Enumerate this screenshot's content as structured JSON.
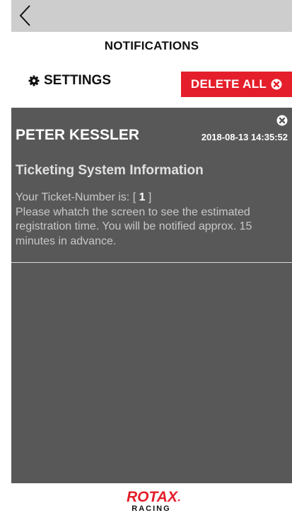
{
  "header": {
    "title": "NOTIFICATIONS"
  },
  "toolbar": {
    "settings_label": "SETTINGS",
    "delete_all_label": "DELETE ALL"
  },
  "notification": {
    "sender": "PETER KESSLER",
    "datetime": "2018-08-13 14:35:52",
    "subject": "Ticketing System Information",
    "body_prefix": "Your Ticket-Number is: [ ",
    "ticket_number": "1",
    "body_suffix": " ]",
    "body_rest": "Please whatch the screen to see the estimated registration time. You will be notified approx. 15 minutes in advance."
  },
  "footer": {
    "logo_text": "ROTAX",
    "logo_subtext": "RACING"
  },
  "colors": {
    "accent": "#e41f2b",
    "panel": "#585858",
    "topbar": "#cdcdcd"
  },
  "icons": {
    "back": "chevron-left-icon",
    "settings": "gear-icon",
    "delete": "close-circle-icon",
    "close": "close-circle-icon"
  }
}
